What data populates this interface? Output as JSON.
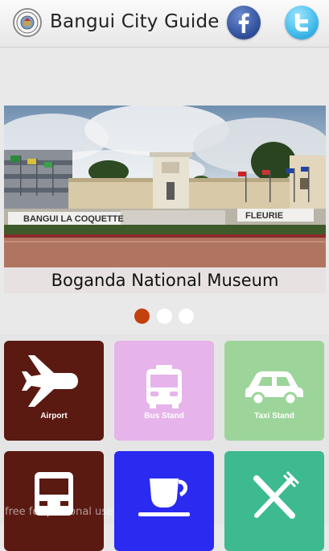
{
  "header": {
    "title": "Bangui City Guide",
    "logo_icon": "city-seal-icon",
    "social": [
      {
        "name": "facebook",
        "icon": "facebook-icon",
        "color": "#3b5998"
      },
      {
        "name": "twitter",
        "icon": "twitter-icon",
        "color": "#33b5e5"
      }
    ]
  },
  "slider": {
    "caption": "Boganda National Museum",
    "sign_left": "BANGUI LA COQUETTE",
    "sign_right": "FLEURIE",
    "dots": [
      {
        "active": true,
        "color": "#c2410c"
      },
      {
        "active": false,
        "color": "#ffffff"
      },
      {
        "active": false,
        "color": "#ffffff"
      }
    ]
  },
  "tiles": [
    {
      "label": "Airport",
      "icon": "airplane-icon",
      "color": "#5a1a12"
    },
    {
      "label": "Bus Stand",
      "icon": "bus-icon",
      "color": "#e6b3ea"
    },
    {
      "label": "Taxi Stand",
      "icon": "taxi-icon",
      "color": "#9dd49a"
    },
    {
      "label": "",
      "icon": "train-icon",
      "color": "#5a1a12"
    },
    {
      "label": "",
      "icon": "coffee-cup-icon",
      "color": "#2a2af0"
    },
    {
      "label": "",
      "icon": "fork-knife-icon",
      "color": "#3dba8f"
    }
  ],
  "watermark": "free for personal use"
}
